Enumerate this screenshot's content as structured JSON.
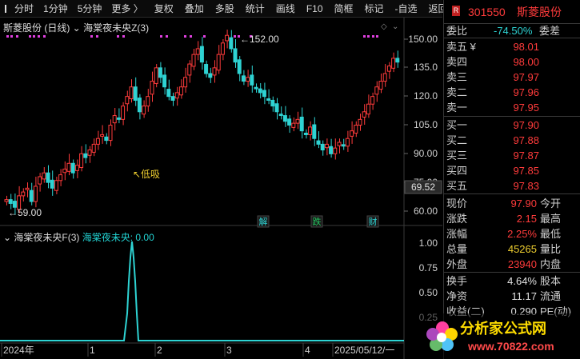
{
  "toolbar": {
    "items": [
      "分时",
      "1分钟",
      "5分钟",
      "更多 〉",
      "复权",
      "叠加",
      "多股",
      "统计",
      "画线",
      "F10",
      "简框",
      "标记",
      "-自选",
      "返回"
    ]
  },
  "chart": {
    "stock_label": "斯菱股份 (日线)",
    "indicator_label": "海棠夜未央Z(3)",
    "y_ticks": [
      "150.00",
      "135.0",
      "120.0",
      "105.0",
      "90.00",
      "75.00",
      "60.00"
    ],
    "current_price_tag": "69.52",
    "high_marker": "152.00",
    "low_marker": "59.00",
    "signal_label": "低吸",
    "event_markers": [
      "解",
      "跌",
      "财"
    ],
    "x_labels": [
      "2024年",
      "1",
      "2",
      "3",
      "4",
      "2025/05/12/一"
    ]
  },
  "indicator": {
    "title": "海棠夜未央F(3)",
    "value_label": "海棠夜未央: 0.00",
    "y_ticks": [
      "1.00",
      "0.75",
      "0.50",
      "0.25"
    ]
  },
  "quote": {
    "header_badge": "R",
    "code": "301550",
    "name": "斯菱股份",
    "weibi_label": "委比",
    "weibi_value": "-74.50%",
    "weicha_label": "委差",
    "asks": [
      {
        "label": "卖五 ¥",
        "price": "98.01"
      },
      {
        "label": "卖四",
        "price": "98.00"
      },
      {
        "label": "卖三",
        "price": "97.97"
      },
      {
        "label": "卖二",
        "price": "97.96"
      },
      {
        "label": "卖一",
        "price": "97.95"
      }
    ],
    "bids": [
      {
        "label": "买一",
        "price": "97.90"
      },
      {
        "label": "买二",
        "price": "97.88"
      },
      {
        "label": "买三",
        "price": "97.87"
      },
      {
        "label": "买四",
        "price": "97.85"
      },
      {
        "label": "买五",
        "price": "97.83"
      }
    ],
    "stats": [
      {
        "label": "现价",
        "value": "97.90",
        "label2": "今开"
      },
      {
        "label": "涨跌",
        "value": "2.15",
        "label2": "最高"
      },
      {
        "label": "涨幅",
        "value": "2.25%",
        "label2": "最低"
      },
      {
        "label": "总量",
        "value": "45265",
        "label2": "量比"
      },
      {
        "label": "外盘",
        "value": "23940",
        "label2": "内盘"
      }
    ],
    "stats2": [
      {
        "label": "换手",
        "value": "4.64%",
        "label2": "股本"
      },
      {
        "label": "净资",
        "value": "11.17",
        "label2": "流通"
      },
      {
        "label": "收益(二)",
        "value": "0.290",
        "label2": "PE(动)"
      }
    ]
  },
  "watermark": {
    "title": "分析家公式网",
    "url": "www.70822.com"
  },
  "colors": {
    "up": "#ff3b3b",
    "down": "#2ed3d3",
    "price_red": "#ff3b3b",
    "volume_yellow": "#f0d030",
    "marker_magenta": "#e040e0"
  }
}
